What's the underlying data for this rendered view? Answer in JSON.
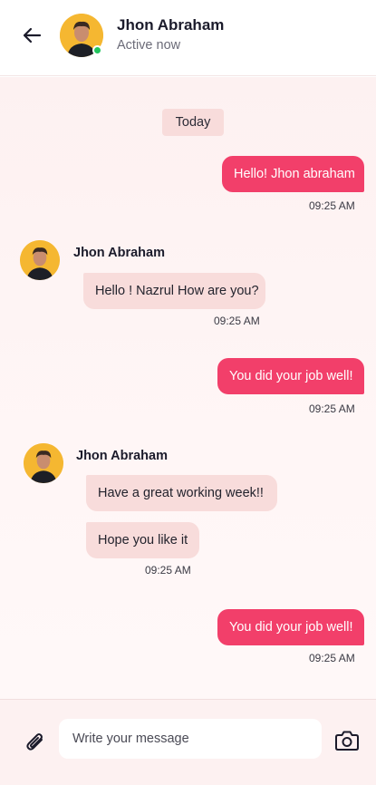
{
  "header": {
    "name": "Jhon Abraham",
    "status": "Active now"
  },
  "chat": {
    "date_label": "Today",
    "messages": [
      {
        "direction": "out",
        "text": "Hello! Jhon abraham",
        "time": "09:25 AM"
      },
      {
        "direction": "in",
        "sender": "Jhon Abraham",
        "text": "Hello ! Nazrul How are you?",
        "time": "09:25 AM"
      },
      {
        "direction": "out",
        "text": "You did your job well!",
        "time": "09:25 AM"
      },
      {
        "direction": "in",
        "sender": "Jhon Abraham",
        "texts": [
          "Have a great working week!!",
          "Hope you like it"
        ],
        "time": "09:25 AM"
      },
      {
        "direction": "out",
        "text": "You did your job well!",
        "time": "09:25 AM"
      }
    ]
  },
  "composer": {
    "placeholder": "Write your message"
  },
  "icons": {
    "back": "arrow-left-icon",
    "attach": "paperclip-icon",
    "camera": "camera-icon",
    "online": "online-status-dot"
  },
  "colors": {
    "outgoing_bubble": "#f23f6a",
    "incoming_bubble": "#f8dcdb",
    "online": "#22c55e",
    "avatar_bg": "#f5b731"
  }
}
